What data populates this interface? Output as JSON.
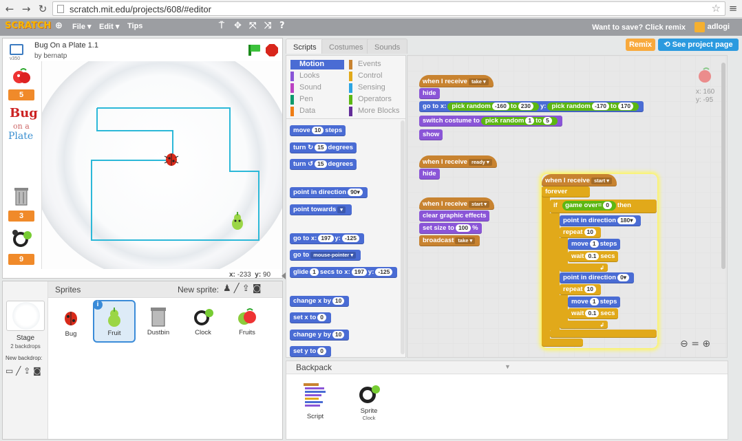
{
  "browser": {
    "url": "scratch.mit.edu/projects/608/#editor"
  },
  "menu": {
    "logo": "SCRATCH",
    "file": "File ▾",
    "edit": "Edit ▾",
    "tips": "Tips",
    "save_prompt": "Want to save? Click remix",
    "user": "adlogi"
  },
  "stage": {
    "title": "Bug On a Plate 1.1",
    "author": "by bernatp",
    "version": "v350",
    "x_label": "x:",
    "x_val": "-233",
    "y_label": "y:",
    "y_val": "90",
    "counters": [
      "5",
      "3",
      "9"
    ],
    "logo_bug": "Bug",
    "logo_ona": "on a",
    "logo_plate": "Plate"
  },
  "sprites": {
    "header": "Sprites",
    "new_sprite": "New sprite:",
    "stage_label": "Stage",
    "stage_sub": "2 backdrops",
    "new_backdrop": "New backdrop:",
    "items": [
      {
        "name": "Bug"
      },
      {
        "name": "Fruit"
      },
      {
        "name": "Dustbin"
      },
      {
        "name": "Clock"
      },
      {
        "name": "Fruits"
      }
    ]
  },
  "tabs": {
    "scripts": "Scripts",
    "costumes": "Costumes",
    "sounds": "Sounds"
  },
  "buttons": {
    "remix": "Remix",
    "see_project": "See project page"
  },
  "categories": [
    "Motion",
    "Looks",
    "Sound",
    "Pen",
    "Data",
    "Events",
    "Control",
    "Sensing",
    "Operators",
    "More Blocks"
  ],
  "category_colors": {
    "Motion": "#4a6cd4",
    "Looks": "#8a55d7",
    "Sound": "#bb42c3",
    "Pen": "#0e9a6c",
    "Data": "#ee7d16",
    "Events": "#c88330",
    "Control": "#e1a91a",
    "Sensing": "#2ca5e2",
    "Operators": "#5cb712",
    "More Blocks": "#632d99"
  },
  "palette": {
    "move": "move",
    "move_n": "10",
    "steps": "steps",
    "turn": "turn",
    "turn_n": "15",
    "degrees": "degrees",
    "point_dir": "point in direction",
    "point_dir_n": "90▾",
    "point_towards": "point towards",
    "goto_xy": "go to x:",
    "gx": "197",
    "y": "y:",
    "gy": "-125",
    "goto": "go to",
    "mouse": "mouse-pointer ▾",
    "glide": "glide",
    "glide_n": "1",
    "secs_to_x": "secs to x:",
    "glx": "197",
    "gly": "-125",
    "change_x": "change x by",
    "cx": "10",
    "set_x": "set x to",
    "sx": "0",
    "change_y": "change y by",
    "cy": "10",
    "set_y": "set y to",
    "sy": "0"
  },
  "scripts": {
    "when_receive": "when I receive",
    "take": "take ▾",
    "ready": "ready ▾",
    "start": "start ▾",
    "hide": "hide",
    "go_to_x": "go to x:",
    "pick_random": "pick random",
    "to": "to",
    "r1a": "-160",
    "r1b": "230",
    "y": "y:",
    "r2a": "-170",
    "r2b": "170",
    "switch_costume": "switch costume to",
    "r3a": "1",
    "r3b": "5",
    "show": "show",
    "clear_effects": "clear graphic effects",
    "set_size": "set size to",
    "size": "100",
    "pct": "%",
    "broadcast": "broadcast",
    "bc_take": "take ▾",
    "forever": "forever",
    "if": "if",
    "then": "then",
    "game_over": "game over",
    "eq": "=",
    "zero": "0",
    "point_dir": "point in direction",
    "d180": "180▾",
    "d0": "0▾",
    "repeat": "repeat",
    "ten": "10",
    "move": "move",
    "one": "1",
    "steps": "steps",
    "wait": "wait",
    "wt": "0.1",
    "secs": "secs"
  },
  "sprite_info": {
    "x": "x: 160",
    "y": "y: -95"
  },
  "backpack": {
    "title": "Backpack",
    "items": [
      {
        "label": "Script",
        "sub": ""
      },
      {
        "label": "Sprite",
        "sub": "Clock"
      }
    ]
  }
}
